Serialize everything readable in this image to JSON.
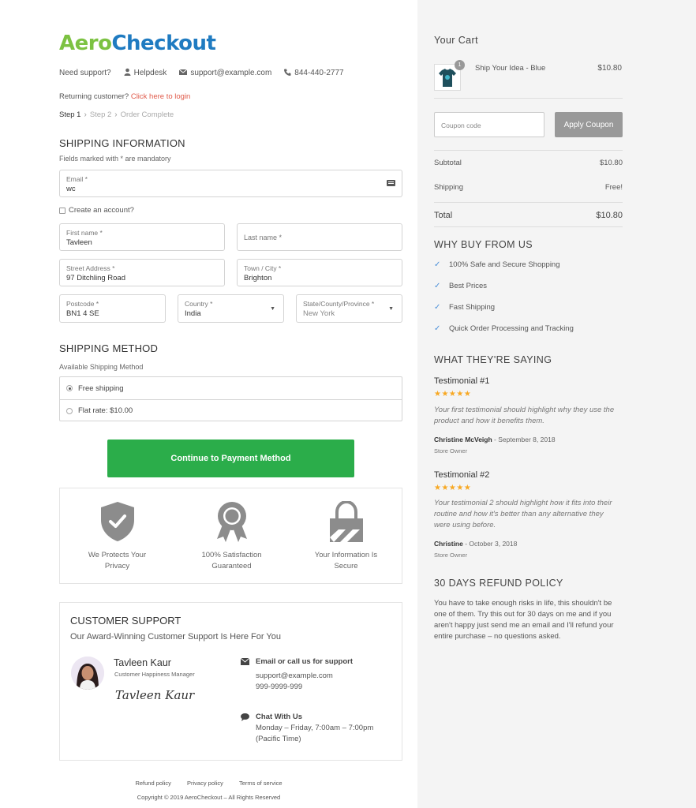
{
  "brand": {
    "part1": "Aero",
    "part2": "Checkout",
    "green": "#7cc242",
    "blue": "#1f7bc1"
  },
  "support": {
    "label": "Need support?",
    "helpdesk": "Helpdesk",
    "email": "support@example.com",
    "phone": "844-440-2777",
    "icons": [
      "user-icon",
      "envelope-icon",
      "phone-icon"
    ]
  },
  "returning": {
    "text": "Returning customer?",
    "link": "Click here to login"
  },
  "steps": {
    "step1": "Step 1",
    "step2": "Step 2",
    "step3": "Order Complete"
  },
  "shipping_info": {
    "title": "SHIPPING INFORMATION",
    "mandatory_note": "Fields marked with * are mandatory",
    "email": {
      "label": "Email *",
      "value": "wc"
    },
    "create_account": "Create an account?",
    "first_name": {
      "label": "First name *",
      "value": "Tavleen"
    },
    "last_name": {
      "placeholder": "Last name *"
    },
    "street": {
      "label": "Street Address *",
      "value": "97 Ditchling Road"
    },
    "town": {
      "label": "Town / City *",
      "value": "Brighton"
    },
    "postcode": {
      "label": "Postcode *",
      "value": "BN1 4 SE"
    },
    "country": {
      "label": "Country *",
      "value": "India"
    },
    "state": {
      "label": "State/County/Province *",
      "placeholder": "New York"
    }
  },
  "shipping_method": {
    "title": "SHIPPING METHOD",
    "subtitle": "Available Shipping Method",
    "options": [
      {
        "label": "Free shipping",
        "selected": true
      },
      {
        "label": "Flat rate: $10.00",
        "selected": false
      }
    ]
  },
  "cta": {
    "label": "Continue to Payment Method",
    "color": "#2bad4a"
  },
  "trust": [
    {
      "icon": "shield-check-icon",
      "line1": "We Protects Your",
      "line2": "Privacy"
    },
    {
      "icon": "award-ribbon-icon",
      "line1": "100% Satisfaction",
      "line2": "Guaranteed"
    },
    {
      "icon": "lock-icon",
      "line1": "Your Information Is",
      "line2": "Secure"
    }
  ],
  "customer_support": {
    "title": "CUSTOMER SUPPORT",
    "subtitle": "Our Award-Winning Customer Support Is Here For You",
    "agent_name": "Tavleen Kaur",
    "agent_role": "Customer Happiness Manager",
    "signature": "Tavleen Kaur",
    "email_title": "Email or call us for support",
    "email": "support@example.com",
    "phone": "999-9999-999",
    "chat_title": "Chat With Us",
    "chat_hours": "Monday – Friday, 7:00am – 7:00pm",
    "chat_tz": "(Pacific Time)"
  },
  "footer": {
    "links": [
      "Refund policy",
      "Privacy policy",
      "Terms of service"
    ],
    "copyright": "Copyright © 2019 AeroCheckout – All Rights Reserved"
  },
  "cart": {
    "title": "Your Cart",
    "item": {
      "name": "Ship Your Idea - Blue",
      "qty": "1",
      "price": "$10.80"
    },
    "coupon_placeholder": "Coupon code",
    "apply_label": "Apply Coupon",
    "subtotal_label": "Subtotal",
    "subtotal": "$10.80",
    "shipping_label": "Shipping",
    "shipping": "Free!",
    "total_label": "Total",
    "total": "$10.80"
  },
  "why_buy": {
    "title": "WHY BUY FROM US",
    "items": [
      "100% Safe and Secure Shopping",
      "Best Prices",
      "Fast Shipping",
      "Quick Order Processing and Tracking"
    ]
  },
  "testimonials": {
    "title": "WHAT THEY'RE SAYING",
    "items": [
      {
        "title": "Testimonial #1",
        "stars": "★★★★★",
        "line1": "Your first testimonial should highlight why they use the",
        "line2": "product and how it benefits them.",
        "line3": "",
        "author": "Christine McVeigh",
        "date": " - September 8, 2018",
        "role": "Store Owner"
      },
      {
        "title": "Testimonial #2",
        "stars": "★★★★★",
        "line1": "Your testimonial 2 should highlight how it fits into their",
        "line2": "routine and how it's better than any alternative they",
        "line3": "were using before.",
        "author": "Christine",
        "date": " - October 3, 2018",
        "role": "Store Owner"
      }
    ]
  },
  "refund": {
    "title": "30 DAYS REFUND POLICY",
    "line1": "You have to take enough risks in life, this shouldn't be",
    "line2": "one of them. Try this out for 30 days on me and if you",
    "line3": "aren't happy just send me an email and I'll refund your",
    "line4": "entire purchase – no questions asked."
  }
}
